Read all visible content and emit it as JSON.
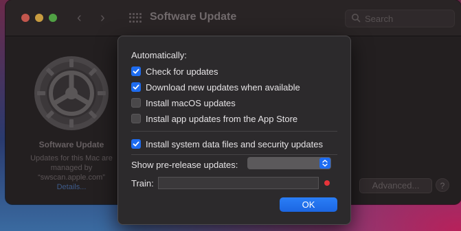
{
  "window": {
    "title": "Software Update",
    "search_placeholder": "Search"
  },
  "left_panel": {
    "title": "Software Update",
    "text_line1": "Updates for this Mac are",
    "text_line2": "managed by",
    "text_line3": "“swscan.apple.com”",
    "details_link": "Details..."
  },
  "buttons": {
    "advanced": "Advanced...",
    "help": "?",
    "ok": "OK"
  },
  "sheet": {
    "section_label": "Automatically:",
    "checkboxes": [
      {
        "label": "Check for updates",
        "checked": true
      },
      {
        "label": "Download new updates when available",
        "checked": true
      },
      {
        "label": "Install macOS updates",
        "checked": false
      },
      {
        "label": "Install app updates from the App Store",
        "checked": false
      },
      {
        "label": "Install system data files and security updates",
        "checked": true
      }
    ],
    "prerelease_label": "Show pre-release updates:",
    "prerelease_value": "",
    "train_label": "Train:",
    "train_value": ""
  },
  "colors": {
    "accent": "#1e6cf0",
    "status_dot": "#e6343a"
  }
}
